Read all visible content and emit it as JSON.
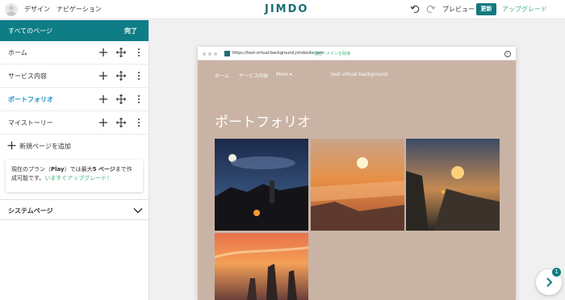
{
  "topbar": {
    "design_label": "デザイン",
    "navigation_label": "ナビゲーション",
    "logo_text": "JIMDO",
    "preview_label": "プレビュー",
    "update_label": "更新",
    "upgrade_label": "アップグレード"
  },
  "sidebar": {
    "header_title": "すべてのページ",
    "done_label": "完了",
    "pages": [
      {
        "label": "ホーム",
        "active": false
      },
      {
        "label": "サービス内容",
        "active": false
      },
      {
        "label": "ポートフォリオ",
        "active": true
      },
      {
        "label": "マイストーリー",
        "active": false
      }
    ],
    "add_page_label": "新規ページを追加",
    "plan": {
      "text_before": "現在のプラン（",
      "plan_name": "Play",
      "text_middle": "）では最大",
      "page_limit": "5 ページ",
      "text_after": "まで作成可能です。",
      "upgrade_now": "いますぐアップグレード！"
    },
    "system_pages_label": "システムページ"
  },
  "preview": {
    "url": "https://test-virtual-background.jimdosite.com",
    "url_hint": "独自ドメインを取得",
    "nav_items": [
      "ホーム",
      "サービス内容",
      "More ▾"
    ],
    "site_title": "test virtual background",
    "page_heading": "ポートフォリオ"
  },
  "fab": {
    "badge": "1"
  },
  "colors": {
    "brand": "#0f7d85",
    "accent_green": "#3eb77a",
    "active_link": "#1a8ec7",
    "preview_bg": "#c9b3a4"
  }
}
